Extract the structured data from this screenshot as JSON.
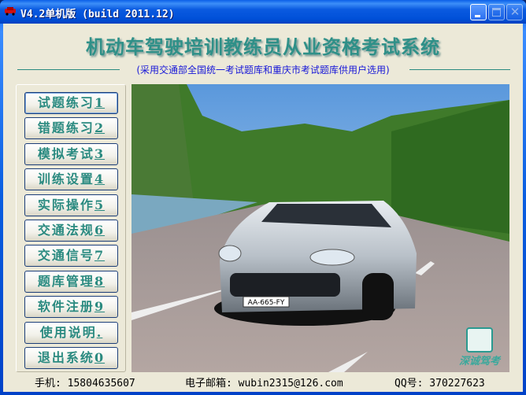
{
  "window": {
    "title": "V4.2单机版 (build 2011.12)"
  },
  "header": {
    "title": "机动车驾驶培训教练员从业资格考试系统",
    "subtitle": "(采用交通部全国统一考试题库和重庆市考试题库供用户选用)"
  },
  "menu": [
    {
      "label": "试题练习",
      "key": "1"
    },
    {
      "label": "错题练习",
      "key": "2"
    },
    {
      "label": "模拟考试",
      "key": "3"
    },
    {
      "label": "训练设置",
      "key": "4"
    },
    {
      "label": "实际操作",
      "key": "5"
    },
    {
      "label": "交通法规",
      "key": "6"
    },
    {
      "label": "交通信号",
      "key": "7"
    },
    {
      "label": "题库管理",
      "key": "8"
    },
    {
      "label": "软件注册",
      "key": "9"
    },
    {
      "label": "使用说明",
      "key": "."
    },
    {
      "label": "退出系统",
      "key": "0"
    }
  ],
  "logo": {
    "text": "深诚驾考"
  },
  "car": {
    "plate": "AA-665-FY"
  },
  "footer": {
    "phone": "手机: 15804635607",
    "email": "电子邮箱: wubin2315@126.com",
    "qq": "QQ号: 370227623"
  }
}
